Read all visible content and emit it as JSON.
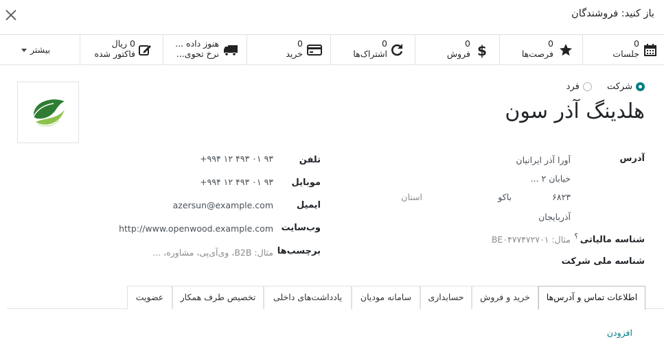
{
  "dialog": {
    "title": "باز کنید: فروشندگان"
  },
  "stats": [
    {
      "num": "0",
      "label": "جلسات",
      "icon": "calendar-icon"
    },
    {
      "num": "0",
      "label": "فرصت‌ها",
      "icon": "star-icon"
    },
    {
      "num": "0",
      "label": "فروش",
      "icon": "dollar-icon"
    },
    {
      "num": "0",
      "label": "اشتراک‌ها",
      "icon": "refresh-icon"
    },
    {
      "num": "0",
      "label": "خرید",
      "icon": "credit-card-icon"
    },
    {
      "num": "هنوز داده ...",
      "label": "نرخ تحوی...",
      "icon": "truck-icon"
    },
    {
      "num": "0 ریال",
      "label": "فاکتور شده",
      "icon": "edit-icon"
    }
  ],
  "more_label": "بیشتر",
  "company_type": {
    "individual": "فرد",
    "company": "شرکت",
    "selected": "company"
  },
  "partner_name": "هلدینگ آذر سون",
  "address": {
    "label": "آدرس",
    "street": "آورا آذر ایرانیان",
    "street2": "خیابان ۲ ...",
    "zip": "۶۸۲۳",
    "city": "باکو",
    "state_placeholder": "استان",
    "country": "آذربایجان"
  },
  "tax_id": {
    "label": "شناسه مالیاتی",
    "help": "؟",
    "placeholder": "مثال: BE۰۴۷۷۴۷۲۷۰۱"
  },
  "company_id": {
    "label": "شناسه ملی شرکت"
  },
  "phone": {
    "label": "تلفن",
    "value": "+۹۹۴ ۱۲ ۴۹۳ ۰۱ ۹۳"
  },
  "mobile": {
    "label": "موبایل",
    "value": "+۹۹۴ ۱۲ ۴۹۳ ۰۱ ۹۳"
  },
  "email": {
    "label": "ایمیل",
    "value": "azersun@example.com"
  },
  "website": {
    "label": "وب‌سایت",
    "value": "http://www.openwood.example.com"
  },
  "tags": {
    "label": "برچسب‌ها",
    "placeholder": "مثال: B2B، وی‌آی‌پی، مشاوره، ..."
  },
  "tabs": [
    "اطلاعات تماس و آدرس‌ها",
    "خرید و فروش",
    "حسابداری",
    "سامانه مودیان",
    "یادداشت‌های داخلی",
    "تخصیص طرف همکار",
    "عضویت"
  ],
  "add_label": "افزودن",
  "colors": {
    "accent": "#017e84",
    "logo_green": "#3e8e2b"
  }
}
